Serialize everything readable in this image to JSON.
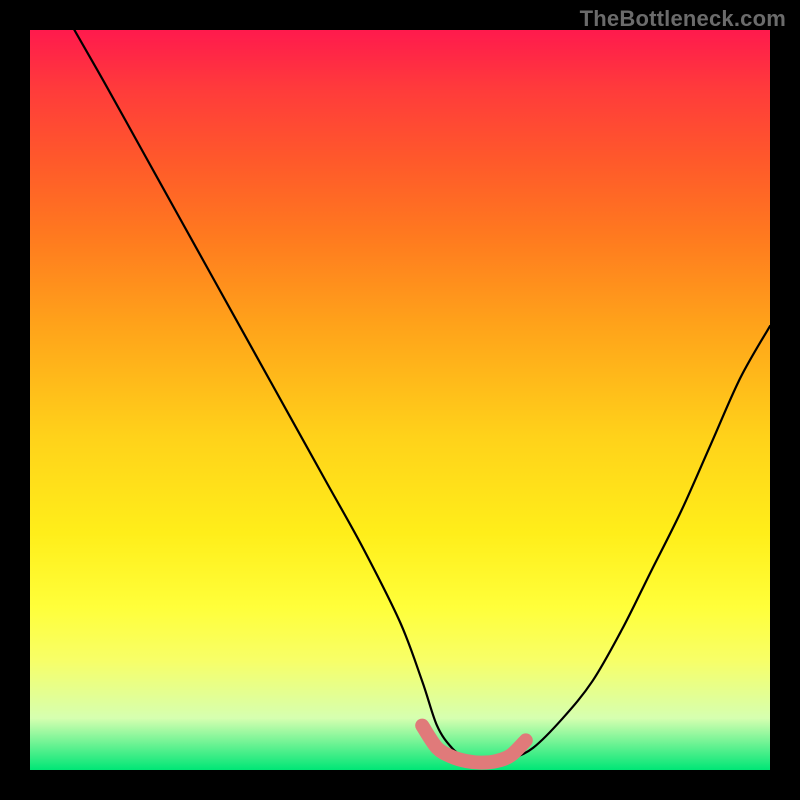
{
  "watermark": "TheBottleneck.com",
  "chart_data": {
    "type": "line",
    "title": "",
    "xlabel": "",
    "ylabel": "",
    "xlim": [
      0,
      100
    ],
    "ylim": [
      0,
      100
    ],
    "grid": false,
    "legend": false,
    "series": [
      {
        "name": "bottleneck-curve",
        "color": "#000000",
        "x": [
          6,
          10,
          15,
          20,
          25,
          30,
          35,
          40,
          45,
          50,
          53,
          55,
          57,
          59,
          61,
          63,
          65,
          68,
          72,
          76,
          80,
          84,
          88,
          92,
          96,
          100
        ],
        "y": [
          100,
          93,
          84,
          75,
          66,
          57,
          48,
          39,
          30,
          20,
          12,
          6,
          3,
          1.5,
          1,
          1,
          1.5,
          3,
          7,
          12,
          19,
          27,
          35,
          44,
          53,
          60
        ]
      },
      {
        "name": "optimum-band",
        "color": "#e07a7a",
        "x": [
          53,
          55,
          57,
          59,
          61,
          63,
          65,
          67
        ],
        "y": [
          6,
          3,
          1.8,
          1.2,
          1,
          1.2,
          2,
          4
        ]
      }
    ],
    "background_gradient": {
      "top": "#ff1a4d",
      "mid": "#ffee1a",
      "bottom": "#00e676"
    }
  }
}
